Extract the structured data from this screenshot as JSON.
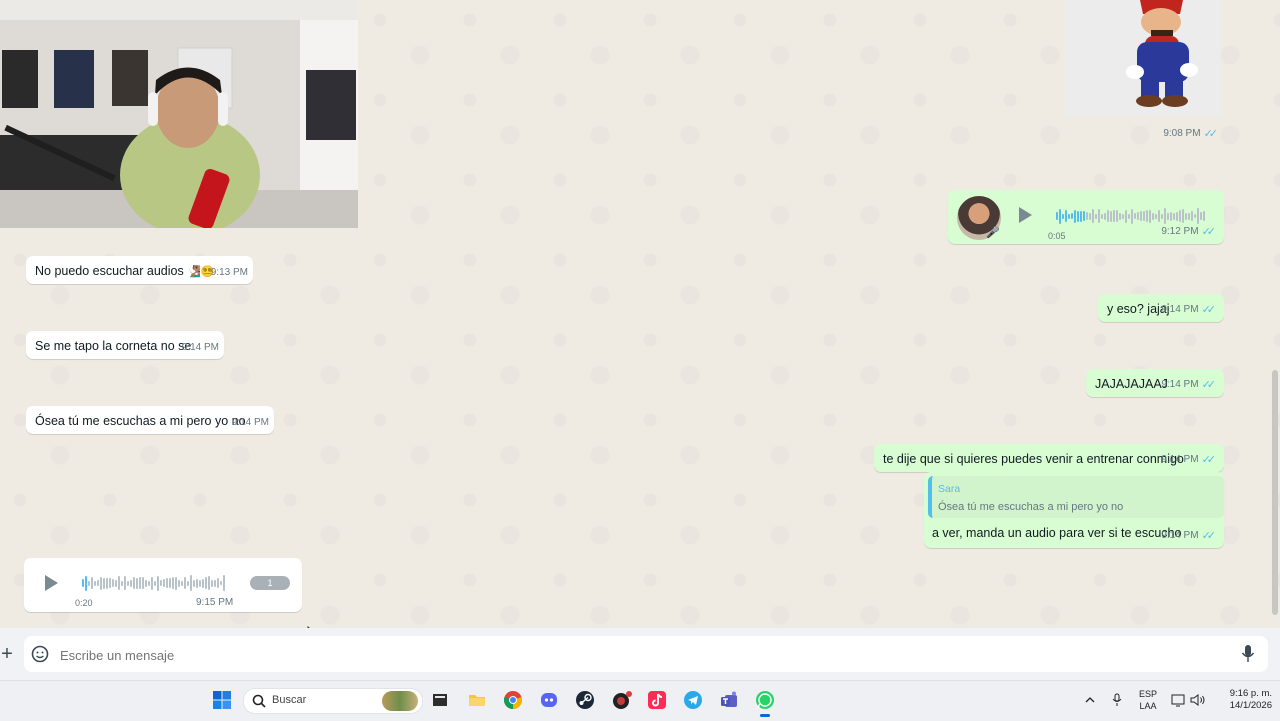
{
  "chat": {
    "incoming": [
      {
        "text": "No puedo escuchar audios",
        "emoji": "🧏🏽‍♂️😵‍💫",
        "time": "9:13 PM"
      },
      {
        "text": "Se me tapo la corneta no se",
        "time": "9:14 PM"
      },
      {
        "text": "Ósea tú me escuchas a mi pero yo no",
        "time": "9:14 PM"
      }
    ],
    "incoming_voice": {
      "duration": "0:20",
      "time": "9:15 PM",
      "unread_badge": "1"
    },
    "outgoing_image_time": "9:08 PM",
    "outgoing_voice": {
      "duration": "0:05",
      "time": "9:12 PM"
    },
    "outgoing": [
      {
        "text": "y eso? jajaj",
        "time": "9:14 PM"
      },
      {
        "text": "JAJAJAJAAJ",
        "time": "9:14 PM"
      },
      {
        "text": "te dije que si quieres puedes venir a entrenar conmigo",
        "time": "9:14 PM"
      }
    ],
    "reply": {
      "quoted_author": "Sara",
      "quoted_text": "Ósea tú me escuchas a mi pero yo no",
      "text": "a ver, manda un audio para ver si te escucho",
      "time": "9:14 PM"
    }
  },
  "composer": {
    "placeholder": "Escribe un mensaje",
    "icons": [
      "plus-icon",
      "sticker-icon",
      "microphone-icon"
    ]
  },
  "taskbar": {
    "search_placeholder": "Buscar",
    "apps": [
      "windows-start-icon",
      "file-explorer-icon",
      "chrome-icon",
      "discord-icon",
      "steam-icon",
      "app-icon",
      "tiktok-icon",
      "telegram-icon",
      "teams-icon",
      "whatsapp-icon"
    ],
    "lang_line1": "ESP",
    "lang_line2": "LAA",
    "time": "9:16 p. m.",
    "date": "14/1/2026"
  },
  "colors": {
    "accent": "#25d366",
    "tick_blue": "#53bdeb",
    "quote_author": "#53bdeb",
    "outgoing_bubble": "#d9fdd3",
    "incoming_bubble": "#ffffff"
  }
}
